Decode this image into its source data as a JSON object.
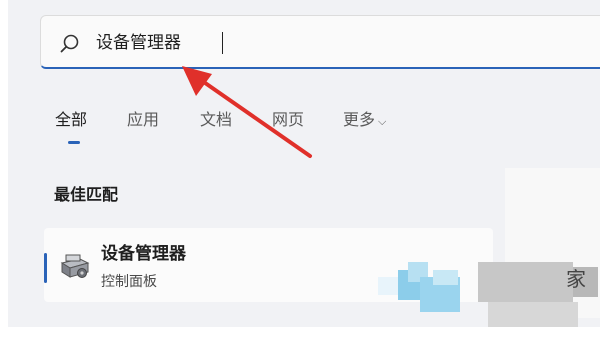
{
  "search": {
    "query": "设备管理器",
    "icon": "search-icon"
  },
  "tabs": [
    {
      "label": "全部",
      "active": true
    },
    {
      "label": "应用",
      "active": false
    },
    {
      "label": "文档",
      "active": false
    },
    {
      "label": "网页",
      "active": false
    },
    {
      "label": "更多",
      "active": false,
      "has_dropdown": true
    }
  ],
  "section": {
    "title": "最佳匹配"
  },
  "best_match": {
    "title": "设备管理器",
    "subtitle": "控制面板",
    "icon": "device-manager-icon"
  },
  "colors": {
    "accent": "#2a63b8",
    "annotation_arrow": "#e0302a",
    "background": "#f1f2f5"
  }
}
